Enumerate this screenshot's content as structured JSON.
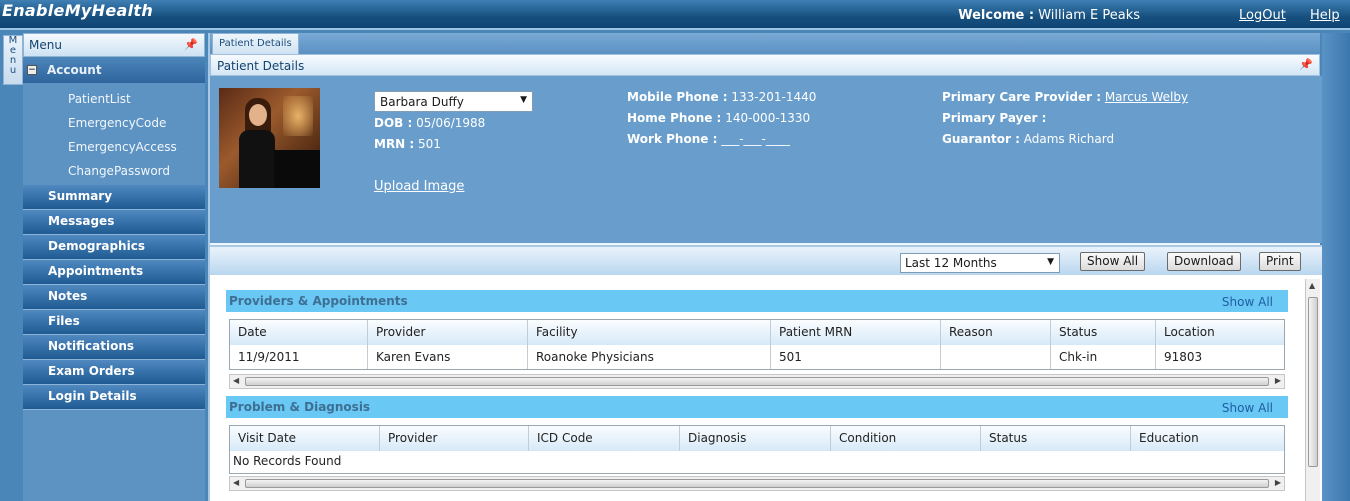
{
  "app": {
    "brand": "EnableMyHealth"
  },
  "header": {
    "welcome_label": "Welcome :",
    "user_name": "William E Peaks",
    "logout": "LogOut",
    "help": "Help"
  },
  "vstrip": {
    "letters": [
      "M",
      "e",
      "n",
      "u"
    ]
  },
  "sidebar": {
    "menu_title": "Menu",
    "account_label": "Account",
    "account_items": [
      "PatientList",
      "EmergencyCode",
      "EmergencyAccess",
      "ChangePassword"
    ],
    "nav_items": [
      "Summary",
      "Messages",
      "Demographics",
      "Appointments",
      "Notes",
      "Files",
      "Notifications",
      "Exam Orders",
      "Login Details"
    ]
  },
  "tabs": {
    "active": "Patient Details"
  },
  "panel": {
    "title": "Patient Details"
  },
  "patient": {
    "selected": "Barbara Duffy",
    "dob_label": "DOB :",
    "dob": "05/06/1988",
    "mrn_label": "MRN :",
    "mrn": "501",
    "upload": "Upload Image",
    "mobile_label": "Mobile Phone :",
    "mobile": "133-201-1440",
    "home_label": "Home Phone :",
    "home": "140-000-1330",
    "work_label": "Work Phone :",
    "work": "___-___-____",
    "pcp_label": "Primary Care Provider :",
    "pcp": "Marcus Welby",
    "payer_label": "Primary Payer :",
    "payer": "",
    "guarantor_label": "Guarantor :",
    "guarantor": "Adams Richard"
  },
  "toolbar": {
    "range": "Last 12 Months",
    "show_all": "Show All",
    "download": "Download",
    "print": "Print"
  },
  "providers": {
    "title": "Providers & Appointments",
    "show_all": "Show All",
    "columns": [
      "Date",
      "Provider",
      "Facility",
      "Patient MRN",
      "Reason",
      "Status",
      "Location"
    ],
    "rows": [
      [
        "11/9/2011",
        "Karen Evans",
        "Roanoke Physicians",
        "501",
        "",
        "Chk-in",
        "91803"
      ]
    ]
  },
  "problems": {
    "title": "Problem & Diagnosis",
    "show_all": "Show All",
    "columns": [
      "Visit Date",
      "Provider",
      "ICD Code",
      "Diagnosis",
      "Condition",
      "Status",
      "Education"
    ],
    "empty": "No Records Found"
  },
  "colors": {
    "brand_blue": "#16507f",
    "panel_blue": "#699ecc",
    "section_blue": "#6ac8f5"
  }
}
